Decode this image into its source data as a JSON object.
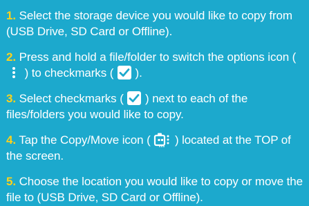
{
  "steps": [
    {
      "number": "1.",
      "text": "Select the storage device you would like to copy from (USB Drive, SD Card or Offline)."
    },
    {
      "number": "2.",
      "text_a": "Press and hold a file/folder to switch the options icon (",
      "text_b": ") to checkmarks (",
      "text_c": ").",
      "icon_a": "kebab-menu-icon",
      "icon_b": "checkmark-icon"
    },
    {
      "number": "3.",
      "text_a": "Select checkmarks (",
      "text_b": ") next to each of the files/folders you would like to copy.",
      "icon_a": "checkmark-icon"
    },
    {
      "number": "4.",
      "text_a": "Tap the Copy/Move icon (",
      "text_b": ") located at the TOP of the screen.",
      "icon_a": "copy-move-icon"
    },
    {
      "number": "5.",
      "text": "Choose the location you would like to copy or move the file to (USB Drive, SD Card or Offline)."
    }
  ],
  "colors": {
    "background": "#1ca9cd",
    "text": "#ffffff",
    "number": "#ffd21a",
    "checkmark_box": "#ffffff",
    "checkmark_tick": "#1ca9cd"
  }
}
